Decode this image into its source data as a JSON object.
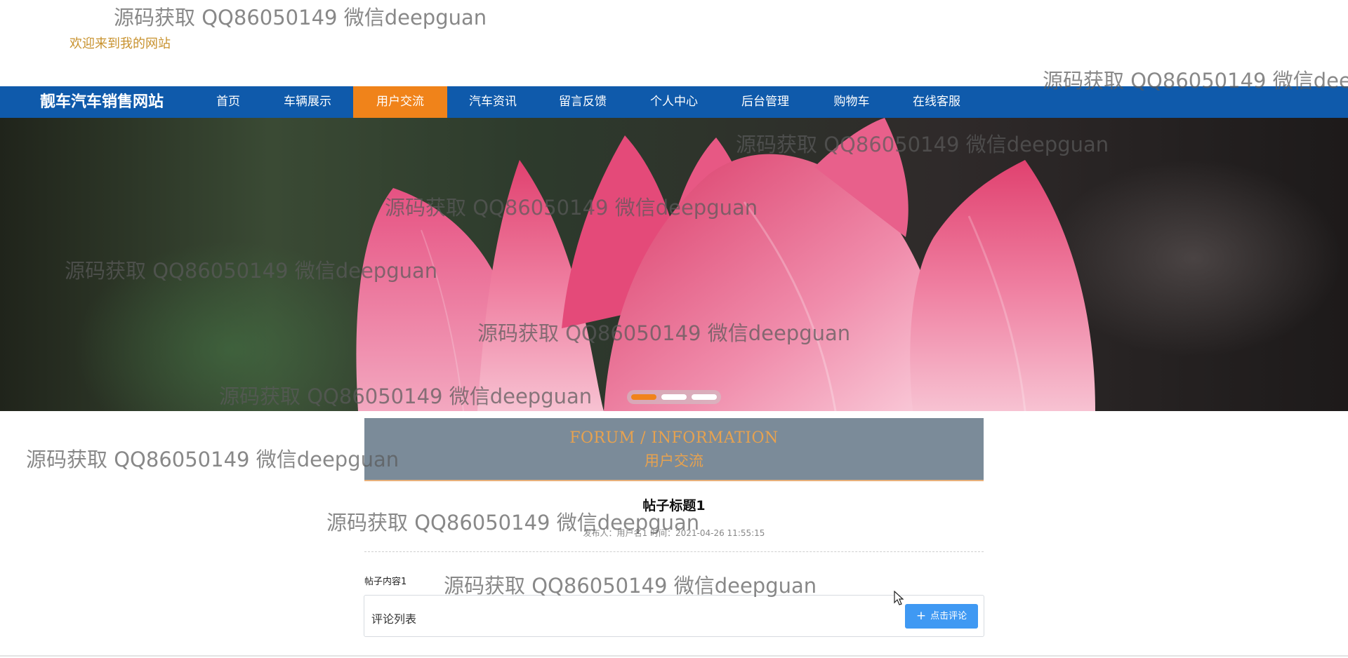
{
  "header": {
    "welcome": "欢迎来到我的网站"
  },
  "nav": {
    "brand": "靓车汽车销售网站",
    "items": [
      {
        "label": "首页",
        "active": false
      },
      {
        "label": "车辆展示",
        "active": false
      },
      {
        "label": "用户交流",
        "active": true
      },
      {
        "label": "汽车资讯",
        "active": false
      },
      {
        "label": "留言反馈",
        "active": false
      },
      {
        "label": "个人中心",
        "active": false
      },
      {
        "label": "后台管理",
        "active": false
      },
      {
        "label": "购物车",
        "active": false
      },
      {
        "label": "在线客服",
        "active": false
      }
    ]
  },
  "banner": {
    "slides": 3,
    "active_slide": 1
  },
  "section": {
    "title_en": "FORUM / INFORMATION",
    "title_cn": "用户交流"
  },
  "post": {
    "title": "帖子标题1",
    "meta": "发布人：用户名1  时间：2021-04-26 11:55:15",
    "content": "帖子内容1"
  },
  "comments": {
    "label": "评论列表",
    "button_label": "点击评论",
    "button_icon": "plus-icon"
  },
  "watermark": "源码获取 QQ86050149 微信deepguan",
  "colors": {
    "nav_bg": "#0f5aab",
    "nav_active": "#f0831a",
    "section_bg": "#7b8b99",
    "section_text": "#e7a24f",
    "button": "#3f99f3",
    "welcome_text": "#c8922e"
  }
}
